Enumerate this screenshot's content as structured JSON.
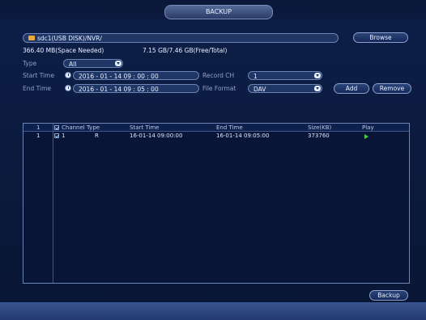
{
  "window": {
    "title": "BACKUP"
  },
  "device": {
    "path": "sdc1(USB DISK)/NVR/",
    "browse_label": "Browse",
    "space_needed": "366.40 MB(Space Needed)",
    "free_total": "7.15 GB/7.46 GB(Free/Total)"
  },
  "form": {
    "type_label": "Type",
    "type_value": "All",
    "start_time_label": "Start Time",
    "start_time_value": "2016 - 01 - 14   09 : 00 : 00",
    "end_time_label": "End Time",
    "end_time_value": "2016 - 01 - 14   09 : 05 : 00",
    "record_ch_label": "Record CH",
    "record_ch_value": "1",
    "file_format_label": "File Format",
    "file_format_value": "DAV",
    "add_label": "Add",
    "remove_label": "Remove"
  },
  "table": {
    "headers": {
      "index": "1",
      "channel": "Channel",
      "type": "Type",
      "start_time": "Start Time",
      "end_time": "End Time",
      "size": "Size(KB)",
      "play": "Play"
    },
    "rows": [
      {
        "index": "1",
        "channel": "1",
        "type": "R",
        "start_time": "16-01-14 09:00:00",
        "end_time": "16-01-14 09:05:00",
        "size": "373760"
      }
    ]
  },
  "actions": {
    "backup_label": "Backup"
  },
  "icons": {
    "folder": "folder-icon",
    "clock": "clock-icon",
    "dropdown": "chevron-down-icon",
    "play": "play-icon",
    "checkbox": "checkbox-icon"
  },
  "colors": {
    "background": "#0b1a3a",
    "accent": "#6d82b5",
    "play": "#3fd04a",
    "folder": "#e8a83a"
  }
}
